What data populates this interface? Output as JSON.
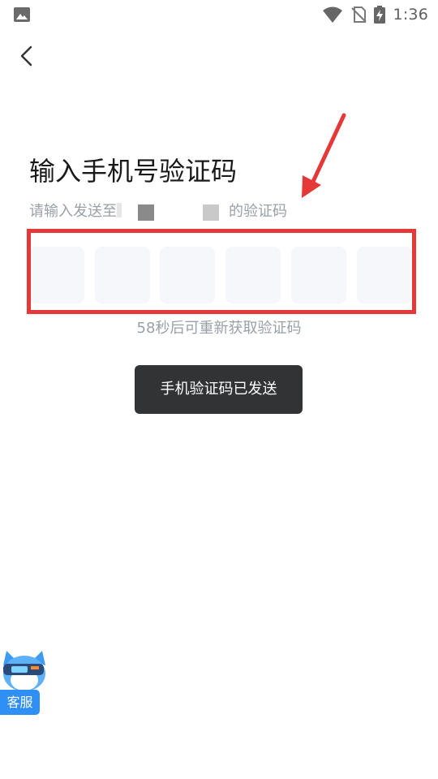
{
  "status_bar": {
    "time": "1:36",
    "icons": [
      "gallery-icon",
      "wifi-icon",
      "no-sim-icon",
      "battery-charging-icon"
    ]
  },
  "nav": {
    "back_icon": "chevron-left-icon"
  },
  "title": "输入手机号验证码",
  "subtitle": {
    "prefix": "请输入发送至",
    "suffix": "的验证码"
  },
  "code_input": {
    "cells": [
      "",
      "",
      "",
      "",
      "",
      ""
    ]
  },
  "resend_text": "58秒后可重新获取验证码",
  "toast": "手机验证码已发送",
  "customer_service": {
    "label": "客服",
    "icon": "cat-mascot-icon"
  },
  "colors": {
    "annotation_red": "#e53838",
    "toast_bg": "#323335",
    "cell_bg": "#f5f7fa",
    "cs_blue": "#2f8ff5",
    "muted_text": "#9aa0a8"
  }
}
